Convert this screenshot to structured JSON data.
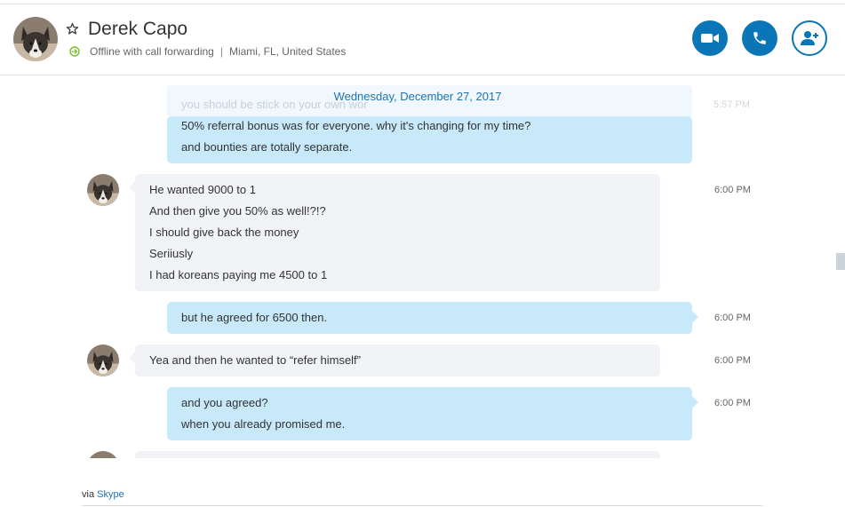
{
  "contact": {
    "name": "Derek Capo",
    "status": "Offline with call forwarding",
    "location": "Miami, FL, United States",
    "separator": "|"
  },
  "colors": {
    "accent": "#0a76b8",
    "outgoing_bubble": "#c7e9fa",
    "incoming_bubble": "#f1f3f6",
    "status_green": "#7cbd2f"
  },
  "icons": {
    "favorite": "star-outline-icon",
    "status": "arrow-forward-circle-icon",
    "video_call": "video-camera-icon",
    "audio_call": "phone-icon",
    "add_people": "add-person-icon"
  },
  "conversation": {
    "date": "Wednesday, December 27, 2017",
    "partial_top": {
      "text": "you should be stick on your own wor",
      "time": "5:57 PM"
    },
    "messages": [
      {
        "sender": "me",
        "lines": [
          "50% referral bonus was for everyone. why it's changing for my time?",
          "and bounties are totally separate."
        ],
        "time": ""
      },
      {
        "sender": "contact",
        "lines": [
          "He wanted 9000 to 1",
          "And then give you 50% as well!?!?",
          "I should give back the money",
          "Seriiusly",
          "I had koreans paying me 4500 to 1"
        ],
        "time": "6:00 PM"
      },
      {
        "sender": "me",
        "lines": [
          "but he agreed for 6500  then."
        ],
        "time": "6:00 PM"
      },
      {
        "sender": "contact",
        "lines": [
          "Yea and then he wanted to “refer himself”"
        ],
        "time": "6:00 PM"
      },
      {
        "sender": "me",
        "lines": [
          "and you agreed?",
          "when you already promised me."
        ],
        "time": "6:00 PM"
      }
    ]
  },
  "footer": {
    "via": "via",
    "link": "Skype"
  }
}
